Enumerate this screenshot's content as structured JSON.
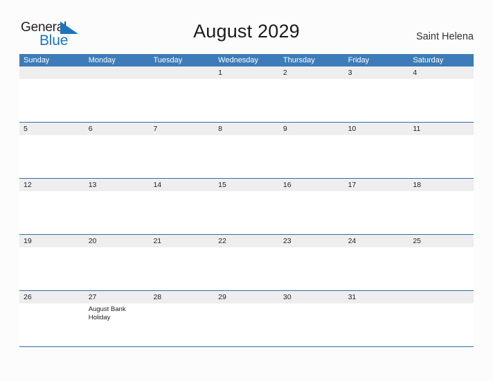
{
  "brand": {
    "name_part1": "General",
    "name_part2": "Blue",
    "flag_icon": "blue-triangle-flag-icon",
    "color_primary": "#1b75bb",
    "color_text": "#231f20"
  },
  "header": {
    "title": "August 2029",
    "location": "Saint Helena"
  },
  "calendar": {
    "header_bg": "#3d7cb8",
    "band_bg": "#eeeeee",
    "row_border": "#2e6da4",
    "weekdays": [
      "Sunday",
      "Monday",
      "Tuesday",
      "Wednesday",
      "Thursday",
      "Friday",
      "Saturday"
    ],
    "weeks": [
      [
        {
          "day": ""
        },
        {
          "day": ""
        },
        {
          "day": ""
        },
        {
          "day": "1"
        },
        {
          "day": "2"
        },
        {
          "day": "3"
        },
        {
          "day": "4"
        }
      ],
      [
        {
          "day": "5"
        },
        {
          "day": "6"
        },
        {
          "day": "7"
        },
        {
          "day": "8"
        },
        {
          "day": "9"
        },
        {
          "day": "10"
        },
        {
          "day": "11"
        }
      ],
      [
        {
          "day": "12"
        },
        {
          "day": "13"
        },
        {
          "day": "14"
        },
        {
          "day": "15"
        },
        {
          "day": "16"
        },
        {
          "day": "17"
        },
        {
          "day": "18"
        }
      ],
      [
        {
          "day": "19"
        },
        {
          "day": "20"
        },
        {
          "day": "21"
        },
        {
          "day": "22"
        },
        {
          "day": "23"
        },
        {
          "day": "24"
        },
        {
          "day": "25"
        }
      ],
      [
        {
          "day": "26"
        },
        {
          "day": "27",
          "event": "August Bank Holiday"
        },
        {
          "day": "28"
        },
        {
          "day": "29"
        },
        {
          "day": "30"
        },
        {
          "day": "31"
        },
        {
          "day": ""
        }
      ]
    ]
  }
}
